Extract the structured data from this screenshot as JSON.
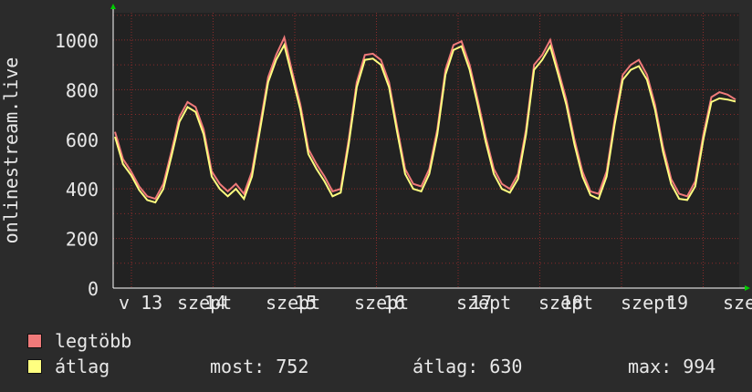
{
  "chart_data": {
    "type": "line",
    "ylabel": "onlinestream.live",
    "yticks": [
      0,
      200,
      400,
      600,
      800,
      1000
    ],
    "ylim": [
      0,
      1110
    ],
    "xticklabels": [
      "v 13",
      "szept",
      "14",
      "szept",
      "15",
      "szept",
      "16",
      "szept",
      "17",
      "szept",
      "18",
      "szept",
      "19",
      "sze"
    ],
    "grid": true,
    "colors": {
      "background": "#2b2b2b",
      "plot_bg": "#222222",
      "grid": "#8a2b2b",
      "axis": "#ffffff",
      "max_line": "#f07a7a",
      "avg_line": "#ffff80",
      "arrow": "#00cc00"
    },
    "series": [
      {
        "name": "legtöbb",
        "color": "#f07a7a",
        "points": [
          [
            0,
            630
          ],
          [
            2,
            520
          ],
          [
            4,
            470
          ],
          [
            6,
            410
          ],
          [
            8,
            370
          ],
          [
            10,
            360
          ],
          [
            12,
            420
          ],
          [
            14,
            550
          ],
          [
            16,
            690
          ],
          [
            18,
            750
          ],
          [
            20,
            730
          ],
          [
            22,
            640
          ],
          [
            24,
            470
          ],
          [
            26,
            420
          ],
          [
            28,
            390
          ],
          [
            30,
            420
          ],
          [
            32,
            380
          ],
          [
            34,
            470
          ],
          [
            36,
            660
          ],
          [
            38,
            850
          ],
          [
            40,
            940
          ],
          [
            42,
            1010
          ],
          [
            44,
            870
          ],
          [
            46,
            740
          ],
          [
            48,
            560
          ],
          [
            50,
            500
          ],
          [
            52,
            450
          ],
          [
            54,
            390
          ],
          [
            56,
            400
          ],
          [
            58,
            600
          ],
          [
            60,
            830
          ],
          [
            62,
            940
          ],
          [
            64,
            945
          ],
          [
            66,
            920
          ],
          [
            68,
            830
          ],
          [
            70,
            650
          ],
          [
            72,
            480
          ],
          [
            74,
            420
          ],
          [
            76,
            410
          ],
          [
            78,
            480
          ],
          [
            80,
            640
          ],
          [
            82,
            880
          ],
          [
            84,
            980
          ],
          [
            86,
            995
          ],
          [
            88,
            900
          ],
          [
            90,
            760
          ],
          [
            92,
            610
          ],
          [
            94,
            480
          ],
          [
            96,
            420
          ],
          [
            98,
            400
          ],
          [
            100,
            460
          ],
          [
            102,
            640
          ],
          [
            104,
            900
          ],
          [
            106,
            940
          ],
          [
            108,
            1000
          ],
          [
            110,
            880
          ],
          [
            112,
            760
          ],
          [
            114,
            600
          ],
          [
            116,
            470
          ],
          [
            118,
            390
          ],
          [
            120,
            380
          ],
          [
            122,
            470
          ],
          [
            124,
            680
          ],
          [
            126,
            860
          ],
          [
            128,
            900
          ],
          [
            130,
            920
          ],
          [
            132,
            860
          ],
          [
            134,
            740
          ],
          [
            136,
            570
          ],
          [
            138,
            440
          ],
          [
            140,
            380
          ],
          [
            142,
            370
          ],
          [
            144,
            430
          ],
          [
            146,
            620
          ],
          [
            148,
            770
          ],
          [
            150,
            790
          ],
          [
            152,
            780
          ],
          [
            154,
            760
          ]
        ]
      },
      {
        "name": "átlag",
        "color": "#ffff80",
        "points": [
          [
            0,
            610
          ],
          [
            2,
            500
          ],
          [
            4,
            455
          ],
          [
            6,
            395
          ],
          [
            8,
            355
          ],
          [
            10,
            345
          ],
          [
            12,
            400
          ],
          [
            14,
            530
          ],
          [
            16,
            670
          ],
          [
            18,
            730
          ],
          [
            20,
            710
          ],
          [
            22,
            620
          ],
          [
            24,
            450
          ],
          [
            26,
            400
          ],
          [
            28,
            370
          ],
          [
            30,
            400
          ],
          [
            32,
            360
          ],
          [
            34,
            450
          ],
          [
            36,
            640
          ],
          [
            38,
            830
          ],
          [
            40,
            920
          ],
          [
            42,
            980
          ],
          [
            44,
            850
          ],
          [
            46,
            720
          ],
          [
            48,
            540
          ],
          [
            50,
            480
          ],
          [
            52,
            430
          ],
          [
            54,
            370
          ],
          [
            56,
            385
          ],
          [
            58,
            580
          ],
          [
            60,
            810
          ],
          [
            62,
            920
          ],
          [
            64,
            925
          ],
          [
            66,
            900
          ],
          [
            68,
            810
          ],
          [
            70,
            630
          ],
          [
            72,
            460
          ],
          [
            74,
            400
          ],
          [
            76,
            390
          ],
          [
            78,
            460
          ],
          [
            80,
            620
          ],
          [
            82,
            860
          ],
          [
            84,
            960
          ],
          [
            86,
            975
          ],
          [
            88,
            880
          ],
          [
            90,
            740
          ],
          [
            92,
            590
          ],
          [
            94,
            460
          ],
          [
            96,
            400
          ],
          [
            98,
            385
          ],
          [
            100,
            440
          ],
          [
            102,
            620
          ],
          [
            104,
            880
          ],
          [
            106,
            920
          ],
          [
            108,
            975
          ],
          [
            110,
            860
          ],
          [
            112,
            740
          ],
          [
            114,
            580
          ],
          [
            116,
            450
          ],
          [
            118,
            375
          ],
          [
            120,
            360
          ],
          [
            122,
            450
          ],
          [
            124,
            660
          ],
          [
            126,
            840
          ],
          [
            128,
            880
          ],
          [
            130,
            895
          ],
          [
            132,
            840
          ],
          [
            134,
            720
          ],
          [
            136,
            550
          ],
          [
            138,
            420
          ],
          [
            140,
            360
          ],
          [
            142,
            355
          ],
          [
            144,
            410
          ],
          [
            146,
            600
          ],
          [
            148,
            750
          ],
          [
            150,
            765
          ],
          [
            152,
            760
          ],
          [
            154,
            752
          ]
        ]
      }
    ]
  },
  "legend": {
    "max_label": "legtöbb",
    "avg_label": "átlag"
  },
  "stats": {
    "current": "most: 752",
    "average": "átlag: 630",
    "maximum": "max: 994"
  }
}
